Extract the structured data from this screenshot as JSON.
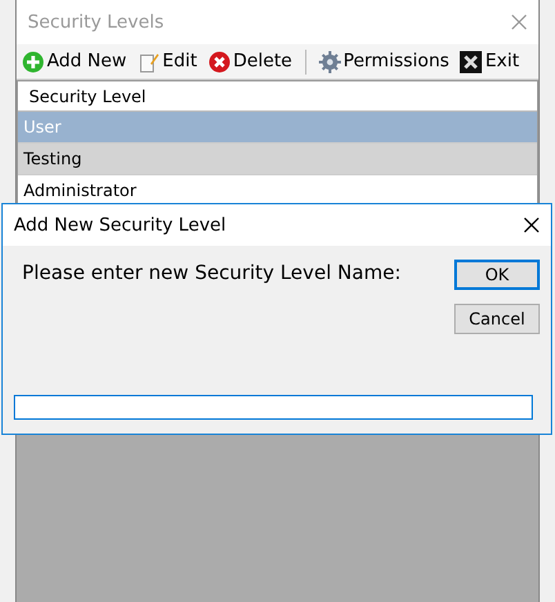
{
  "window": {
    "title": "Security Levels"
  },
  "toolbar": [
    {
      "kind": "add",
      "label": "Add New"
    },
    {
      "kind": "edit",
      "label": "Edit"
    },
    {
      "kind": "delete",
      "label": "Delete"
    },
    {
      "kind": "separator"
    },
    {
      "kind": "permissions",
      "label": "Permissions"
    },
    {
      "kind": "exit",
      "label": "Exit"
    }
  ],
  "table": {
    "columns": [
      "Security Level"
    ],
    "rows": [
      {
        "cells": [
          "User"
        ],
        "selected": true
      },
      {
        "cells": [
          "Testing"
        ],
        "selected": false
      },
      {
        "cells": [
          "Administrator"
        ],
        "selected": false
      }
    ]
  },
  "dialog": {
    "title": "Add New Security Level",
    "prompt": "Please enter new Security Level Name:",
    "buttons": [
      {
        "label": "OK",
        "default": true
      },
      {
        "label": "Cancel",
        "default": false
      }
    ],
    "input": {
      "focused": true
    }
  }
}
